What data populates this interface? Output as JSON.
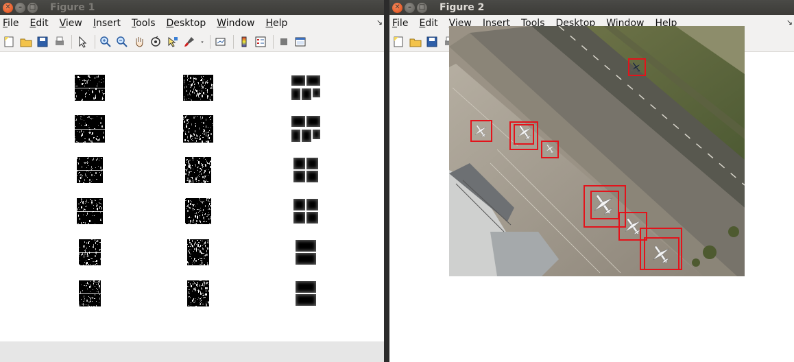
{
  "windows": [
    {
      "id": "figure1",
      "title": "Figure 1",
      "menus": [
        "File",
        "Edit",
        "View",
        "Insert",
        "Tools",
        "Desktop",
        "Window",
        "Help"
      ]
    },
    {
      "id": "figure2",
      "title": "Figure 2",
      "menus": [
        "File",
        "Edit",
        "View",
        "Insert",
        "Tools",
        "Desktop",
        "Window",
        "Help"
      ]
    }
  ],
  "toolbar_icons": [
    "new-figure-icon",
    "open-file-icon",
    "save-icon",
    "print-icon",
    "separator",
    "edit-plot-arrow-icon",
    "separator",
    "zoom-in-icon",
    "zoom-out-icon",
    "pan-hand-icon",
    "rotate-3d-icon",
    "data-cursor-icon",
    "brush-icon",
    "brush-dropdown-icon",
    "separator",
    "link-plot-icon",
    "separator",
    "colorbar-icon",
    "legend-icon",
    "separator",
    "hide-plot-tools-icon",
    "show-plot-tools-icon"
  ],
  "figure1_grid": {
    "rows": 6,
    "cols": 3,
    "styles": [
      "hog-noise",
      "hog-noise",
      "blur-blocks"
    ]
  },
  "figure2_detections": 8,
  "colors": {
    "detection_box": "#e3131b",
    "titlebar": "#3c3b37",
    "menubar": "#f2f1f0"
  }
}
